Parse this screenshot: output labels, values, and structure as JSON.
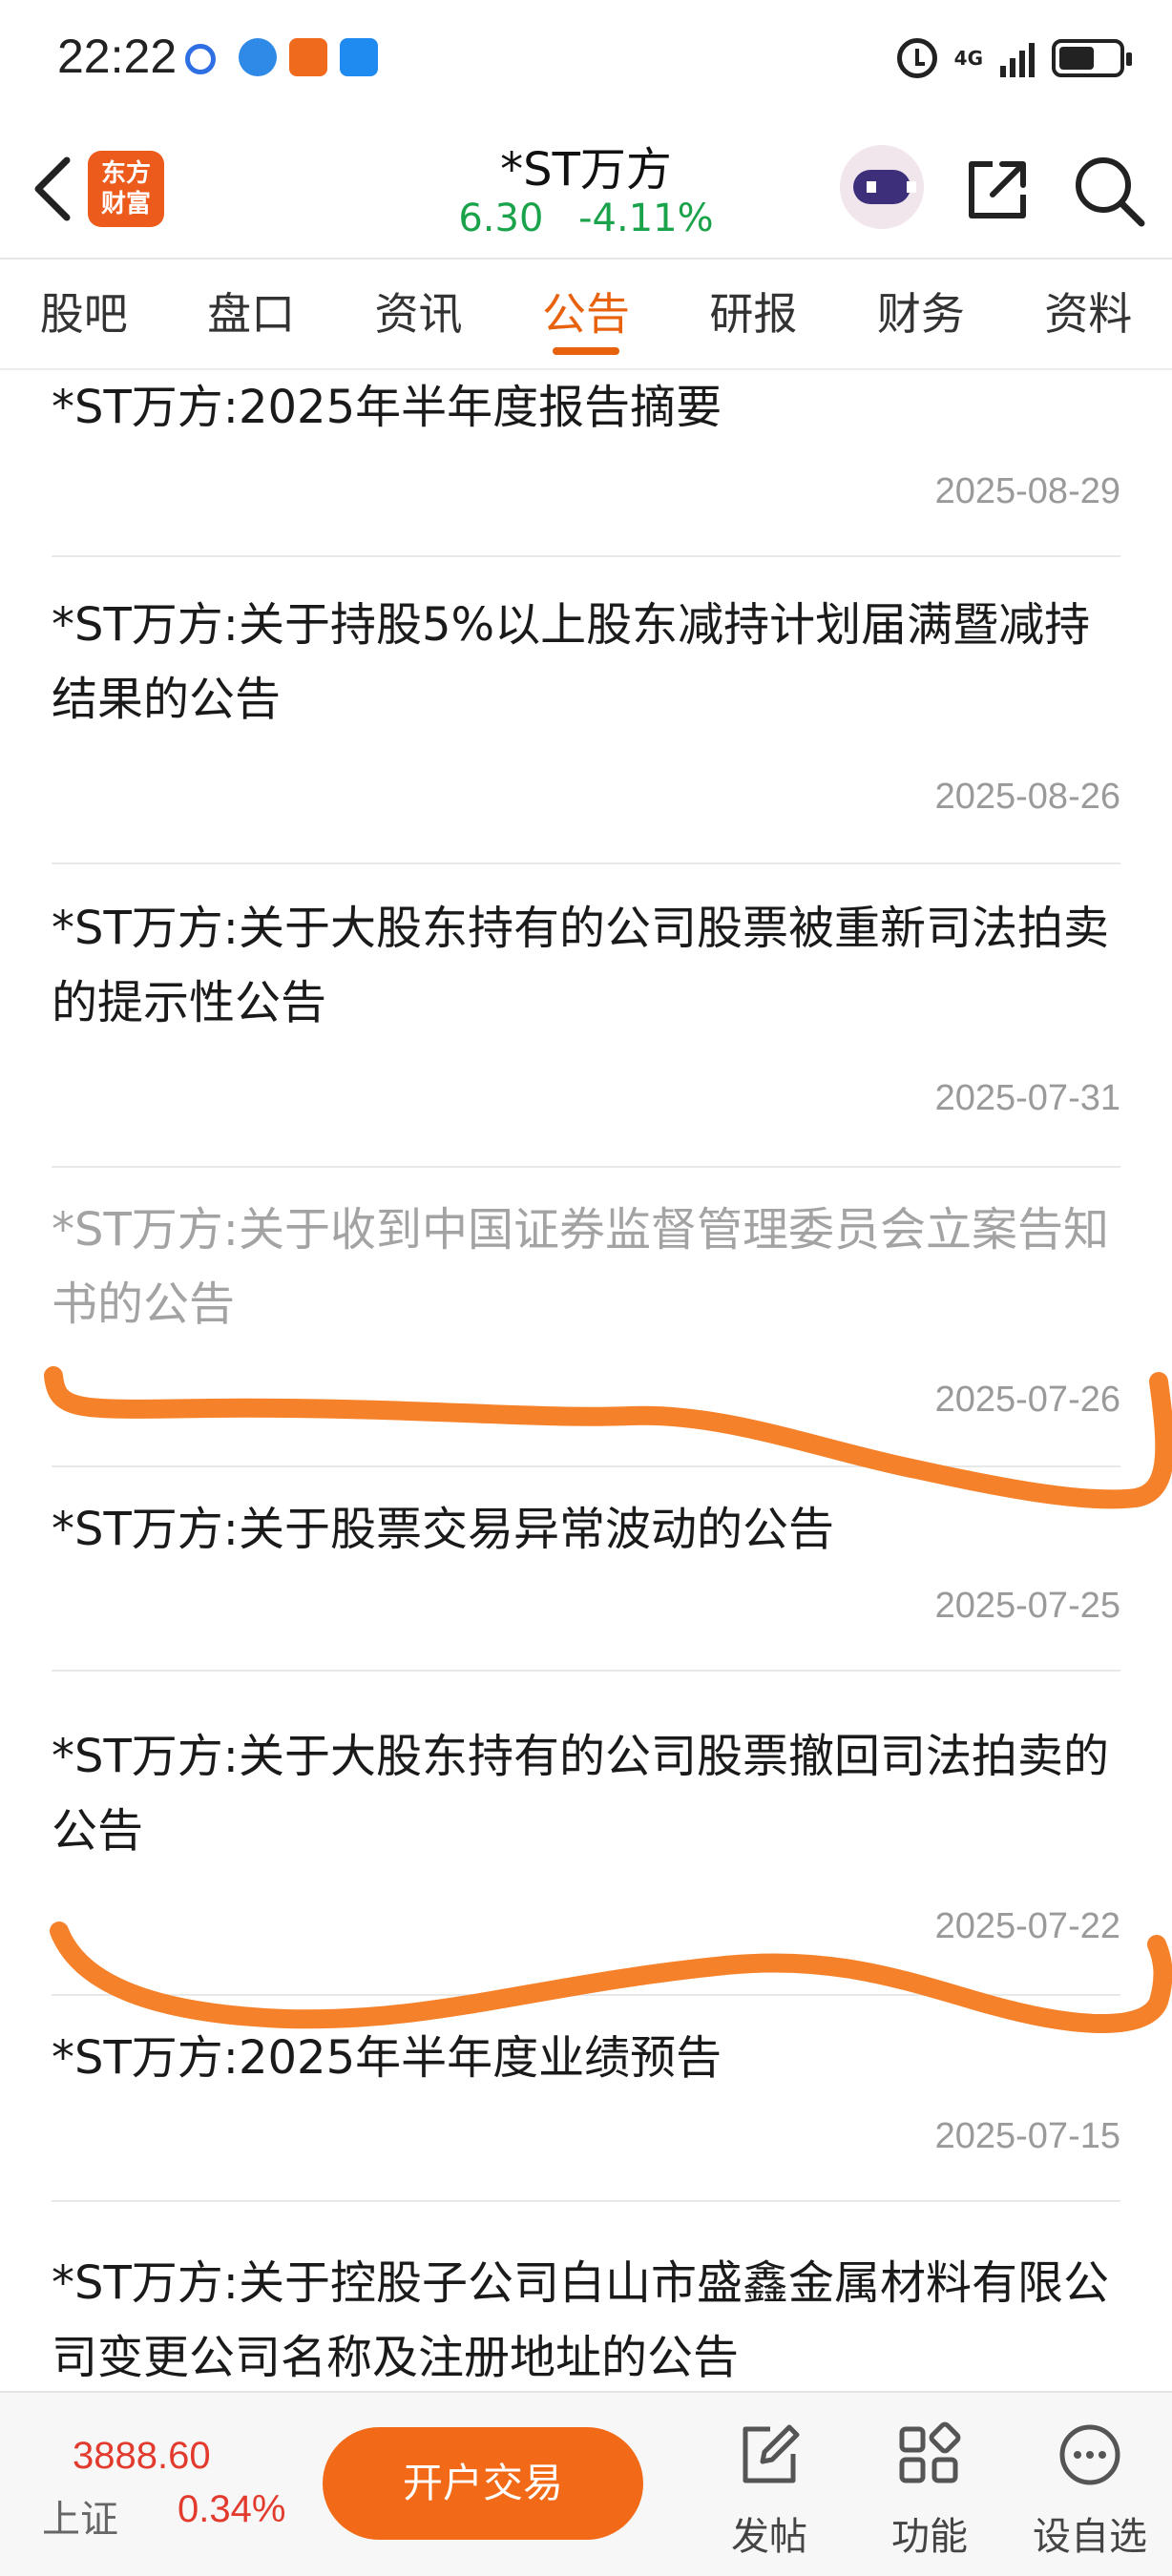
{
  "status_bar": {
    "time": "22:22",
    "network": "4G"
  },
  "header": {
    "logo_text_line1": "东方",
    "logo_text_line2": "财富",
    "stock_name": "*ST万方",
    "price": "6.30",
    "change_pct": "-4.11%"
  },
  "tabs": [
    {
      "label": "股吧"
    },
    {
      "label": "盘口"
    },
    {
      "label": "资讯"
    },
    {
      "label": "公告",
      "active": true
    },
    {
      "label": "研报"
    },
    {
      "label": "财务"
    },
    {
      "label": "资料"
    }
  ],
  "announcements": [
    {
      "title": "*ST万方:2025年半年度报告摘要",
      "date": "2025-08-29"
    },
    {
      "title": "*ST万方:关于持股5%以上股东减持计划届满暨减持结果的公告",
      "date": "2025-08-26"
    },
    {
      "title": "*ST万方:关于大股东持有的公司股票被重新司法拍卖的提示性公告",
      "date": "2025-07-31"
    },
    {
      "title": "*ST万方:关于收到中国证券监督管理委员会立案告知书的公告",
      "date": "2025-07-26",
      "read": true
    },
    {
      "title": "*ST万方:关于股票交易异常波动的公告",
      "date": "2025-07-25"
    },
    {
      "title": "*ST万方:关于大股东持有的公司股票撤回司法拍卖的公告",
      "date": "2025-07-22"
    },
    {
      "title": "*ST万方:2025年半年度业绩预告",
      "date": "2025-07-15"
    },
    {
      "title": "*ST万方:关于控股子公司白山市盛鑫金属材料有限公司变更公司名称及注册地址的公告",
      "date": ""
    }
  ],
  "bottom_bar": {
    "index_value": "3888.60",
    "index_name": "上证",
    "index_change": "0.34%",
    "trade_button": "开户交易",
    "actions": [
      {
        "label": "发帖",
        "icon": "edit-icon"
      },
      {
        "label": "功能",
        "icon": "grid-icon"
      },
      {
        "label": "设自选",
        "icon": "more-icon"
      }
    ]
  },
  "colors": {
    "accent": "#e8620e",
    "down_green": "#1aa34a",
    "up_red": "#e23b2e",
    "marker_orange": "#f5822a"
  }
}
